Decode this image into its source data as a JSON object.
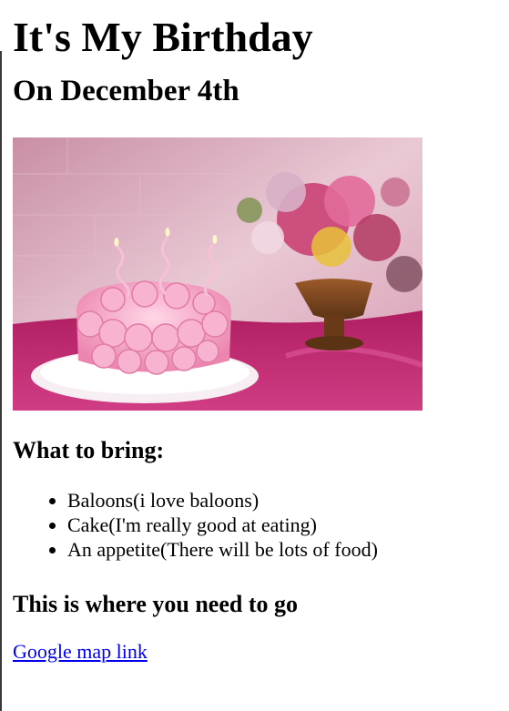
{
  "page": {
    "title": "It's My Birthday",
    "subtitle": "On December 4th",
    "image": {
      "icon": "birthday-cake-photo",
      "colors": {
        "background": "#d8a6b8",
        "tablecloth": "#c0266e",
        "cake": "#f4a6c6",
        "plate": "#f6eef2"
      }
    },
    "bring": {
      "heading": "What to bring:",
      "items": [
        "Baloons(i love baloons)",
        "Cake(I'm really good at eating)",
        "An appetite(There will be lots of food)"
      ]
    },
    "location": {
      "heading": "This is where you need to go",
      "link_label": "Google map link",
      "link_color": "#0000ee"
    }
  }
}
